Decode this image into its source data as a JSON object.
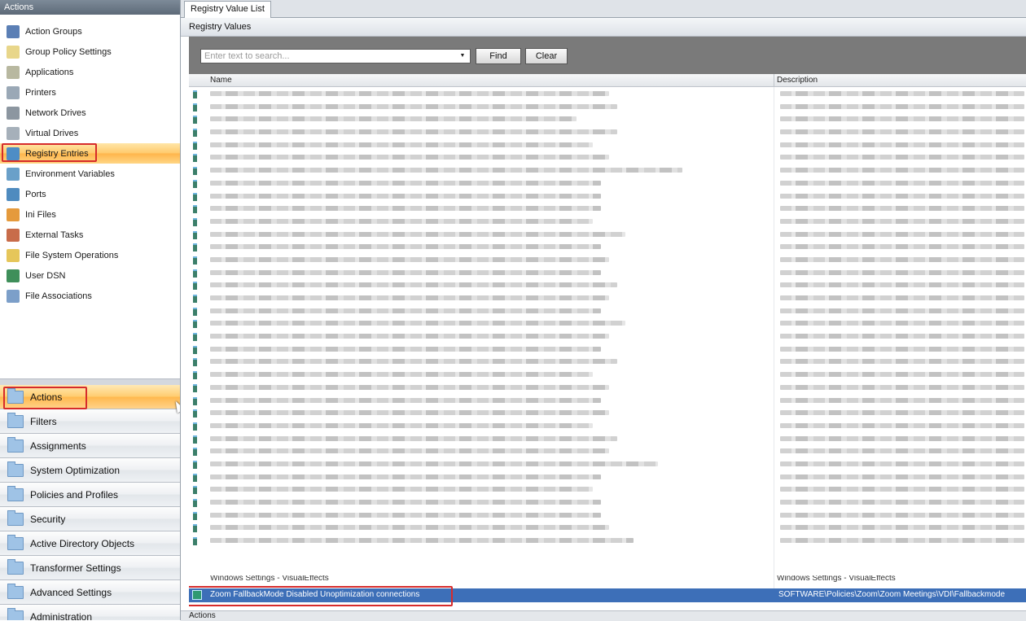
{
  "left_panel": {
    "header": "Actions",
    "actions": [
      {
        "label": "Action Groups",
        "icon": "action-groups-icon",
        "color": "#5b7fb5"
      },
      {
        "label": "Group Policy Settings",
        "icon": "group-policy-icon",
        "color": "#e8d68a"
      },
      {
        "label": "Applications",
        "icon": "applications-icon",
        "color": "#b8b8a0"
      },
      {
        "label": "Printers",
        "icon": "printer-icon",
        "color": "#9aa8b6"
      },
      {
        "label": "Network Drives",
        "icon": "network-drive-icon",
        "color": "#8c96a0"
      },
      {
        "label": "Virtual Drives",
        "icon": "virtual-drive-icon",
        "color": "#a6b0ba"
      },
      {
        "label": "Registry Entries",
        "icon": "registry-icon",
        "color": "#4e8dc6"
      },
      {
        "label": "Environment Variables",
        "icon": "environment-icon",
        "color": "#6aa0c9"
      },
      {
        "label": "Ports",
        "icon": "ports-icon",
        "color": "#4f8bbf"
      },
      {
        "label": "Ini Files",
        "icon": "ini-file-icon",
        "color": "#e59a3c"
      },
      {
        "label": "External Tasks",
        "icon": "external-tasks-icon",
        "color": "#c86c4a"
      },
      {
        "label": "File System Operations",
        "icon": "file-system-icon",
        "color": "#e6c65a"
      },
      {
        "label": "User DSN",
        "icon": "user-dsn-icon",
        "color": "#3f8f5a"
      },
      {
        "label": "File Associations",
        "icon": "file-associations-icon",
        "color": "#7c9fc9"
      }
    ],
    "selected_action": "Registry Entries",
    "nav": [
      {
        "label": "Actions"
      },
      {
        "label": "Filters"
      },
      {
        "label": "Assignments"
      },
      {
        "label": "System Optimization"
      },
      {
        "label": "Policies and Profiles"
      },
      {
        "label": "Security"
      },
      {
        "label": "Active Directory Objects"
      },
      {
        "label": "Transformer Settings"
      },
      {
        "label": "Advanced Settings"
      },
      {
        "label": "Administration"
      }
    ],
    "selected_nav": "Actions"
  },
  "main": {
    "tab": "Registry Value List",
    "section_title": "Registry Values",
    "search": {
      "placeholder": "Enter text to search...",
      "value": ""
    },
    "find_label": "Find",
    "clear_label": "Clear",
    "columns": {
      "name": "Name",
      "description": "Description"
    },
    "partial_row": {
      "name": "Windows Settings - VisualEffects",
      "description": "Windows Settings - VisualEffects"
    },
    "selected_row": {
      "name": "Zoom FallbackMode Disabled Unoptimization connections",
      "description": "SOFTWARE\\Policies\\Zoom\\Zoom Meetings\\VDI\\Fallbackmode"
    },
    "bottom_label": "Actions"
  },
  "colors": {
    "selection_orange": "#ffc96b",
    "selected_row_blue": "#3d6fb8",
    "highlight_red": "#d62b2b",
    "toolbar_gray": "#7a7a7a"
  }
}
